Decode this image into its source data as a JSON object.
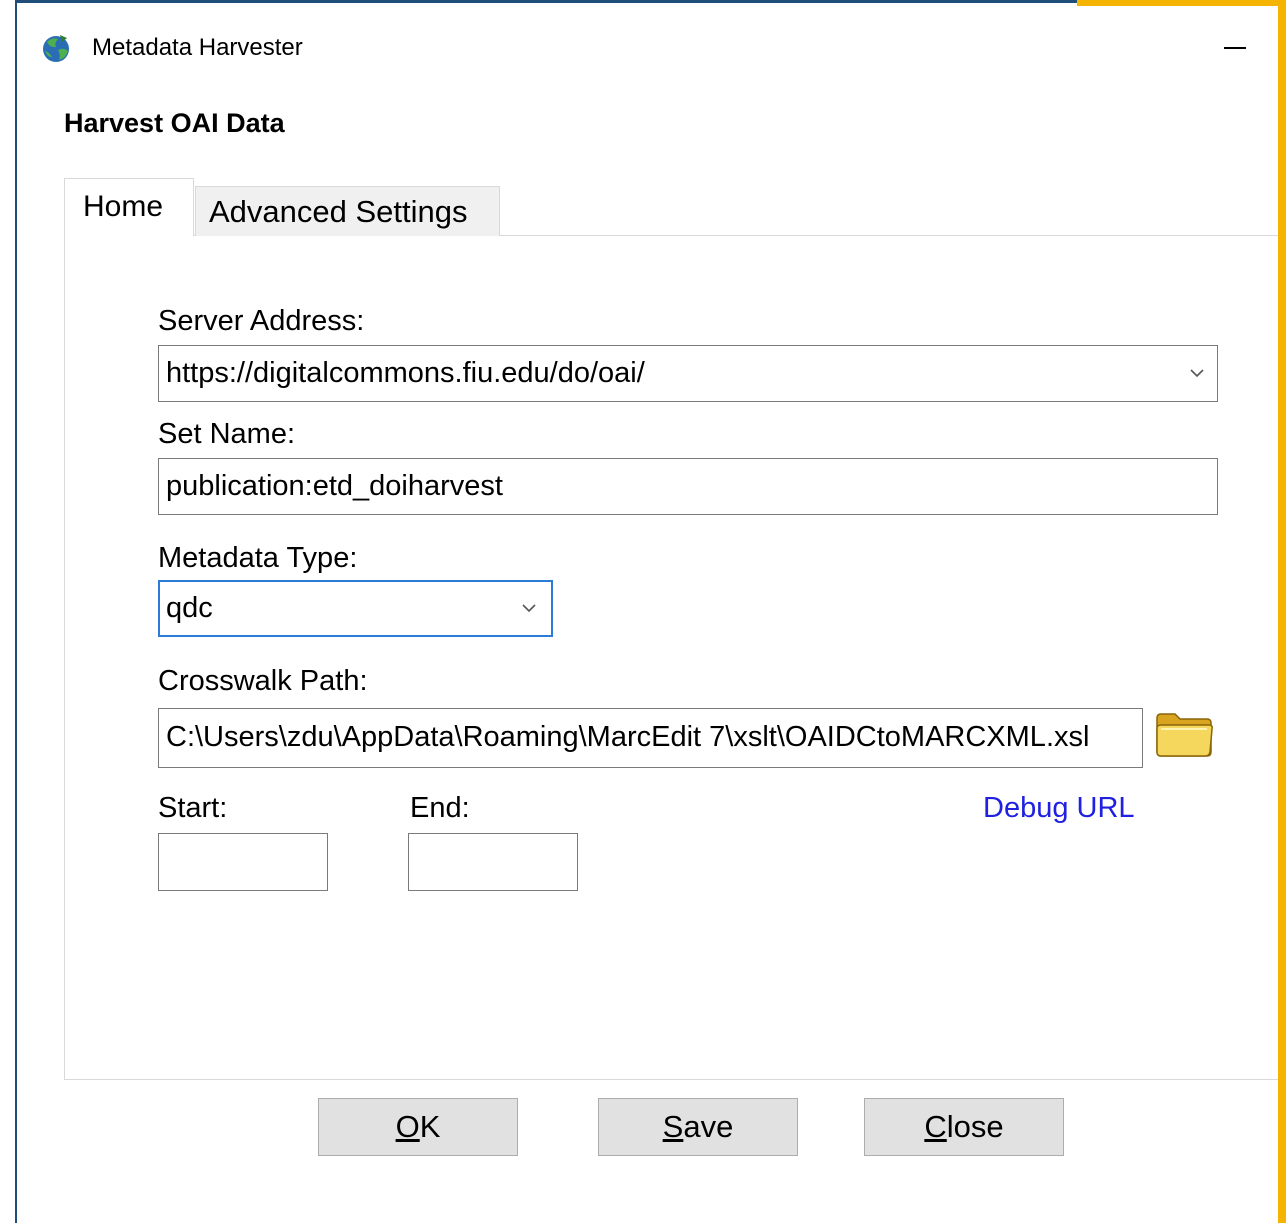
{
  "window": {
    "title": "Metadata Harvester",
    "heading": "Harvest OAI Data"
  },
  "tabs": [
    {
      "label": "Home",
      "active": true
    },
    {
      "label": "Advanced Settings",
      "active": false
    }
  ],
  "form": {
    "server_address_label": "Server Address:",
    "server_address_value": "https://digitalcommons.fiu.edu/do/oai/",
    "set_name_label": "Set Name:",
    "set_name_value": "publication:etd_doiharvest",
    "metadata_type_label": "Metadata Type:",
    "metadata_type_value": "qdc",
    "crosswalk_path_label": "Crosswalk Path:",
    "crosswalk_path_value": "C:\\Users\\zdu\\AppData\\Roaming\\MarcEdit 7\\xslt\\OAIDCtoMARCXML.xsl",
    "start_label": "Start:",
    "start_value": "",
    "end_label": "End:",
    "end_value": "",
    "debug_url_label": "Debug URL"
  },
  "buttons": {
    "ok": {
      "mnemonic": "O",
      "rest": "K"
    },
    "save": {
      "mnemonic": "S",
      "rest": "ave"
    },
    "close": {
      "mnemonic": "C",
      "rest": "lose"
    }
  },
  "icons": {
    "app": "globe-recycle-icon",
    "browse": "folder-icon",
    "minimize": "minimize-icon",
    "dropdown": "chevron-down-icon"
  },
  "colors": {
    "window_border": "#1f4e79",
    "accent": "#f5b400",
    "focus": "#2c7bd6",
    "link": "#2020e0",
    "button_face": "#e1e1e1"
  }
}
